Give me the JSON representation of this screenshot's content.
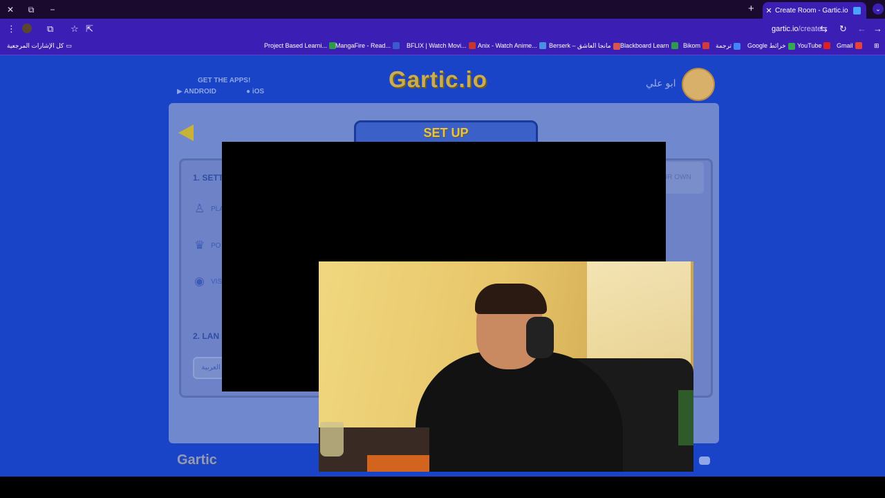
{
  "browser": {
    "tab": {
      "title": "Create Room - Gartic.io",
      "close": "✕"
    },
    "url": {
      "host": "gartic.io",
      "path": "/create"
    },
    "bookmarks_folder": "كل الإشارات المرجعية",
    "bookmarks": [
      {
        "label": "Project Based Learni...",
        "color": "#2e9b4a"
      },
      {
        "label": "MangaFire - Read...",
        "color": "#3a5bd0"
      },
      {
        "label": "BFLIX | Watch Movi...",
        "color": "#c7352f"
      },
      {
        "label": "Anix - Watch Anime...",
        "color": "#4a90e2"
      },
      {
        "label": "Berserk – مانجا العاشق",
        "color": "#d9534f"
      },
      {
        "label": "Blackboard Learn",
        "color": "#2e9b4a"
      },
      {
        "label": "Bikom",
        "color": "#d13a3a"
      },
      {
        "label": "ترجمة",
        "color": "#4285f4"
      },
      {
        "label": "Google خرائط",
        "color": "#34a853"
      },
      {
        "label": "YouTube",
        "color": "#e02020"
      },
      {
        "label": "Gmail",
        "color": "#ea4335"
      }
    ]
  },
  "page": {
    "get_apps": "GET THE APPS!",
    "android": "ANDROID",
    "ios": "iOS",
    "logo": "Gartic.io",
    "username": "ابو علي",
    "setup_title": "SET UP",
    "section1": "1. SETT",
    "section2": "2. LAN",
    "rows": [
      {
        "icon": "user-icon",
        "label": "PLA"
      },
      {
        "icon": "trophy-icon",
        "label": "PO"
      },
      {
        "icon": "eye-icon",
        "label": "VIS"
      }
    ],
    "language_value": "العربية",
    "create_own": "UR OWN",
    "footer_logo": "Gartic"
  }
}
